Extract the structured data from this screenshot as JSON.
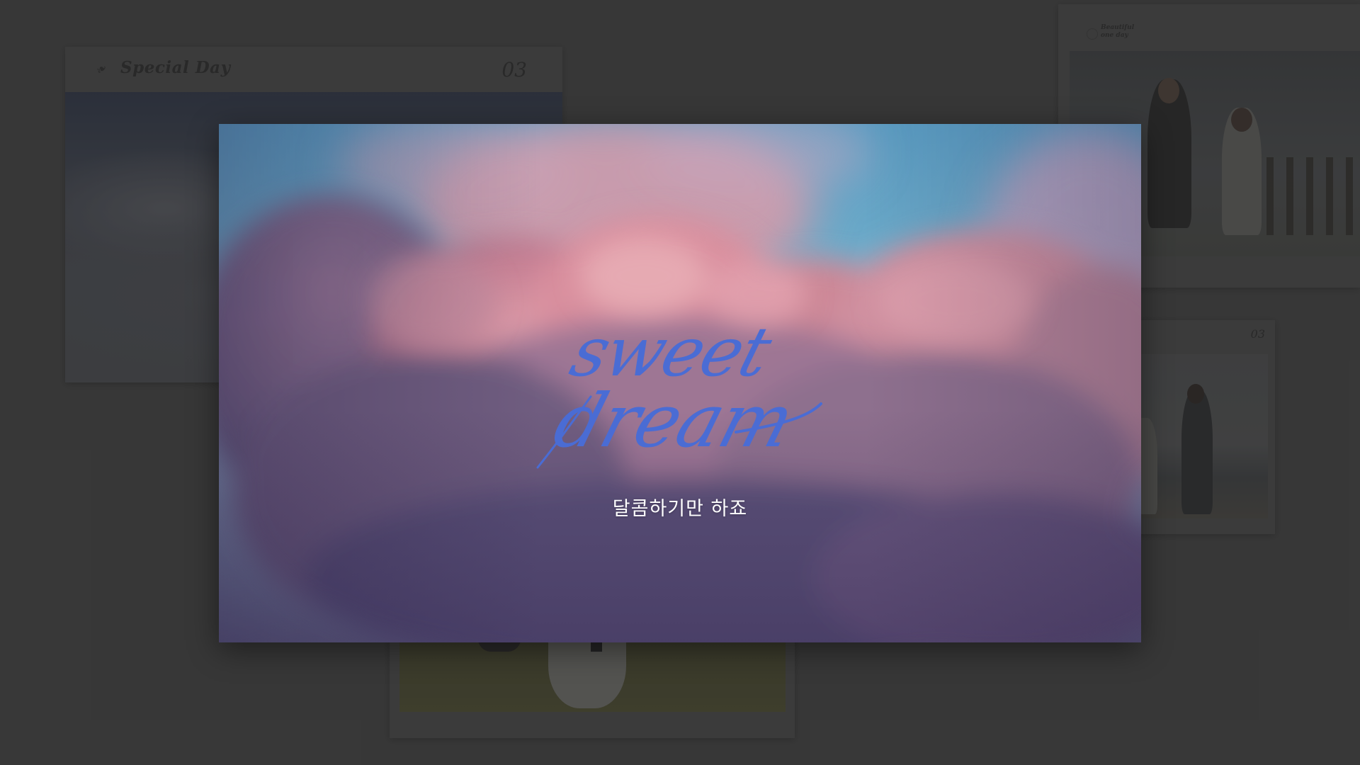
{
  "background_cards": {
    "special_day": {
      "title": "Special Day",
      "number": "03"
    },
    "beautiful_one_day": {
      "title_line1": "Beautiful",
      "title_line2": "one day"
    },
    "right_card": {
      "number": "03"
    }
  },
  "modal": {
    "script_title_line1": "sweet",
    "script_title_line2": "dream",
    "subtitle": "달콤하기만 하죠"
  },
  "colors": {
    "page_background": "#404040",
    "script_title": "#4a6cd4",
    "subtitle_text": "#ffffff",
    "sky_blue": "#6aa8c8",
    "cloud_pink": "#d9909e"
  },
  "icons": {
    "special_day_leaf": "leaf-icon",
    "beautiful_badge": "ring-icon"
  }
}
